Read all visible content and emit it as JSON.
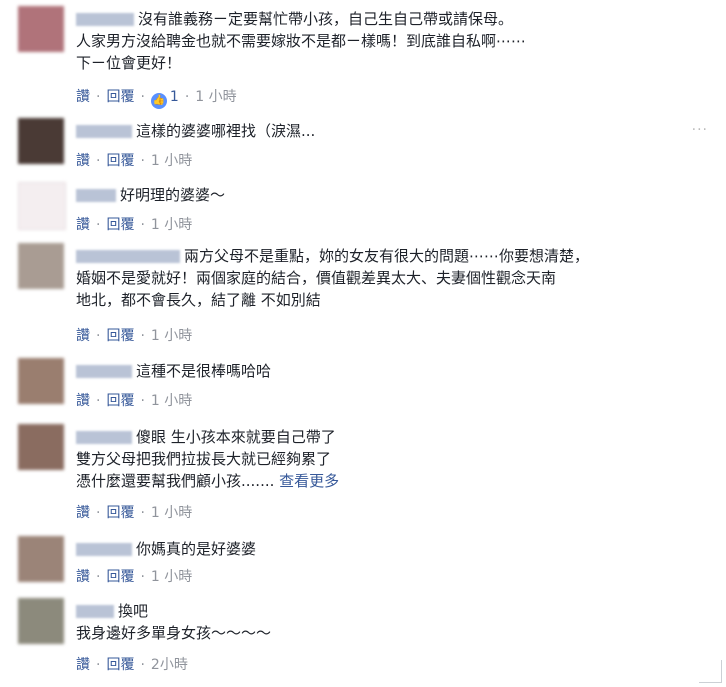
{
  "comments": [
    {
      "lines": [
        "沒有誰義務ㄧ定要幫忙帶小孩，自己生自己帶或請保母。",
        "人家男方沒給聘金也就不需要嫁妝不是都ㄧ樣嗎！到底誰自私啊⋯⋯",
        "下ㄧ位會更好！"
      ],
      "like": "讚",
      "reply": "回覆",
      "reactions": "1",
      "time": "1 小時"
    },
    {
      "lines": [
        "這樣的婆婆哪裡找（淚濕..."
      ],
      "like": "讚",
      "reply": "回覆",
      "time": "1 小時"
    },
    {
      "lines": [
        "好明理的婆婆～"
      ],
      "like": "讚",
      "reply": "回覆",
      "time": "1 小時"
    },
    {
      "lines": [
        "兩方父母不是重點，妳的女友有很大的問題⋯⋯你要想清楚，",
        "婚姻不是愛就好！兩個家庭的結合，價值觀差異太大、夫妻個性觀念天南",
        "地北，都不會長久，結了離 不如別結"
      ],
      "like": "讚",
      "reply": "回覆",
      "time": "1 小時"
    },
    {
      "lines": [
        "這種不是很棒嗎哈哈"
      ],
      "like": "讚",
      "reply": "回覆",
      "time": "1 小時"
    },
    {
      "lines": [
        "傻眼 生小孩本來就要自己帶了",
        "雙方父母把我們拉拔長大就已經夠累了",
        "憑什麼還要幫我們顧小孩......."
      ],
      "more": "查看更多",
      "like": "讚",
      "reply": "回覆",
      "time": "1 小時"
    },
    {
      "lines": [
        "你媽真的是好婆婆"
      ],
      "like": "讚",
      "reply": "回覆",
      "time": "1 小時"
    },
    {
      "lines": [
        "換吧",
        "我身邊好多單身女孩～～～～"
      ],
      "like": "讚",
      "reply": "回覆",
      "time": "2小時"
    }
  ],
  "dots": "···",
  "colors": {
    "link": "#365899",
    "meta": "#90949c",
    "reaction": "#5890ff"
  }
}
